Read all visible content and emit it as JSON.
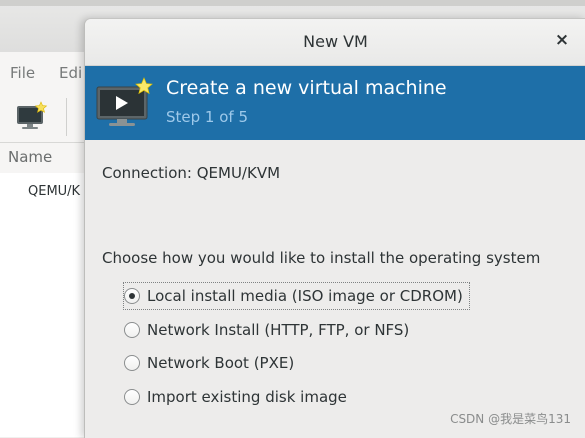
{
  "background": {
    "menu": [
      "File",
      "Edi"
    ],
    "list_header": "Name",
    "connection_row": "QEMU/K"
  },
  "dialog": {
    "title": "New VM",
    "close_glyph": "×",
    "banner": {
      "title": "Create a new virtual machine",
      "step": "Step 1 of 5",
      "icon": "monitor-play-icon"
    },
    "connection_label": "Connection:",
    "connection_value": "QEMU/KVM",
    "prompt": "Choose how you would like to install the operating system",
    "options": [
      {
        "label": "Local install media (ISO image or CDROM)",
        "selected": true
      },
      {
        "label": "Network Install (HTTP, FTP, or NFS)",
        "selected": false
      },
      {
        "label": "Network Boot (PXE)",
        "selected": false
      },
      {
        "label": "Import existing disk image",
        "selected": false
      }
    ]
  },
  "watermark": "CSDN @我是菜鸟131",
  "colors": {
    "banner": "#1e6fa8",
    "banner_step": "#9ec9ea",
    "dialog_bg": "#edeceb"
  }
}
